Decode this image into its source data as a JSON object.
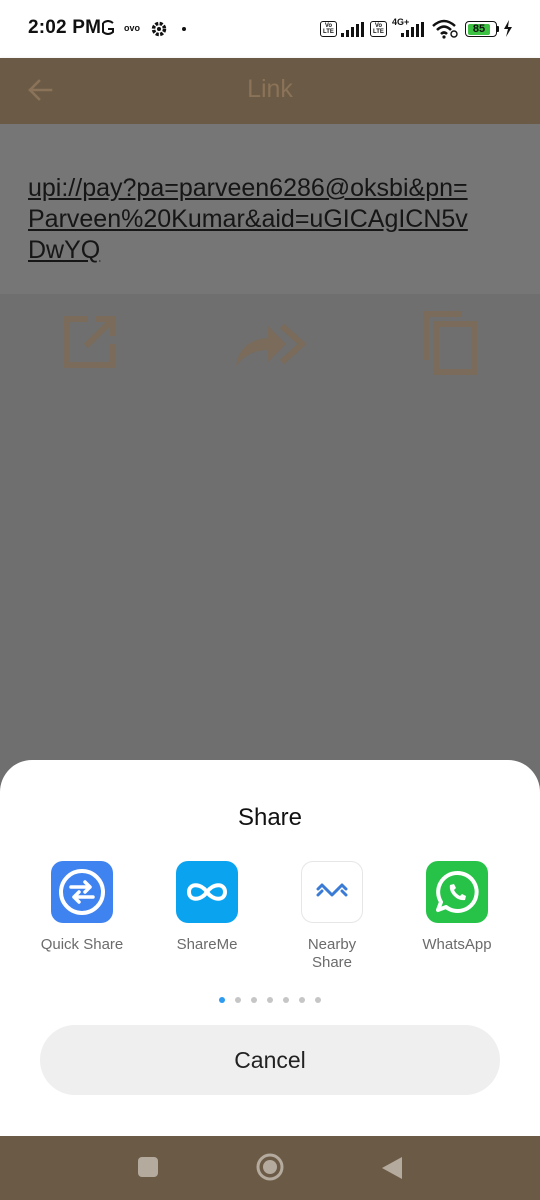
{
  "status_bar": {
    "time": "2:02 PM",
    "volte_1": "Vo LTE",
    "volte_2": "Vo LTE",
    "network_type": "4G+",
    "battery_level": "85",
    "battery_color": "#3cc142",
    "icons": [
      "whatsapp-status-icon",
      "ovo-icon",
      "gear-icon",
      "dot-icon",
      "signal-icon",
      "wifi-icon",
      "charging-icon"
    ]
  },
  "app_bar": {
    "title": "Link",
    "color": "#6b5a45"
  },
  "link": {
    "text": "upi://pay?pa=parveen6286@oksbi&pn=Parveen%20Kumar&aid=uGICAgICN5vDwYQ"
  },
  "actions": [
    "open-external-icon",
    "forward-icon",
    "copy-icon"
  ],
  "share_sheet": {
    "title": "Share",
    "targets": [
      {
        "label": "Quick Share",
        "icon": "quick-share-icon",
        "color": "#3f83f0"
      },
      {
        "label": "ShareMe",
        "icon": "shareme-icon",
        "color": "#0aa3f0"
      },
      {
        "label": "Nearby Share",
        "icon": "nearby-share-icon",
        "color": "#3a7bd5"
      },
      {
        "label": "WhatsApp",
        "icon": "whatsapp-icon",
        "color": "#27c349"
      }
    ],
    "page_count": 7,
    "active_page": 1,
    "cancel_label": "Cancel"
  },
  "nav_bar": {
    "buttons": [
      "recents-button",
      "home-button",
      "back-button"
    ]
  }
}
